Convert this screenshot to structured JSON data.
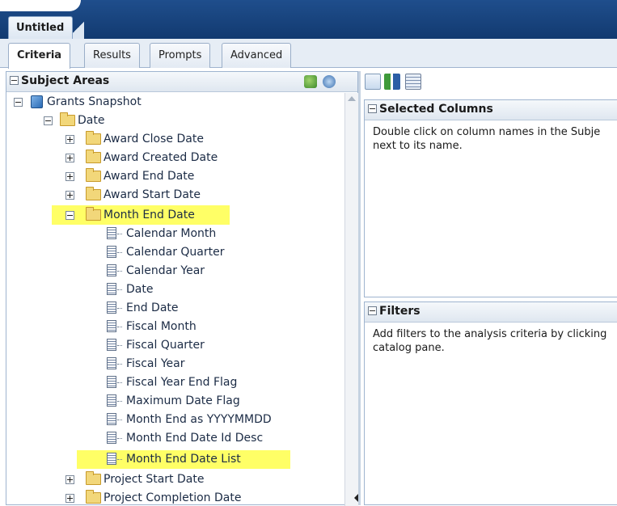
{
  "document_tab": "Untitled",
  "tabs": [
    "Criteria",
    "Results",
    "Prompts",
    "Advanced"
  ],
  "active_tab": "Criteria",
  "subject_areas": {
    "title": "Subject Areas",
    "header_icons": [
      "add-subject-area-icon",
      "refresh-icon"
    ]
  },
  "tree": {
    "root": "Grants Snapshot",
    "date_folder": "Date",
    "folders_before": [
      "Award Close Date",
      "Award Created Date",
      "Award End Date",
      "Award Start Date"
    ],
    "expanded_folder": "Month End Date",
    "columns": [
      "Calendar Month",
      "Calendar Quarter",
      "Calendar Year",
      "Date",
      "End Date",
      "Fiscal Month",
      "Fiscal Quarter",
      "Fiscal Year",
      "Fiscal Year End Flag",
      "Maximum Date Flag",
      "Month End as YYYYMMDD",
      "Month End Date Id Desc",
      "Month End Date List"
    ],
    "folders_after": [
      "Project Start Date",
      "Project Completion Date"
    ]
  },
  "toolbar_icons": [
    "filter-icon",
    "sort-icon",
    "column-properties-icon"
  ],
  "selected_columns": {
    "title": "Selected Columns",
    "text_line1": "Double click on column names in the Subje",
    "text_line2": "next to its name."
  },
  "filters": {
    "title": "Filters",
    "text_line1": "Add filters to the analysis criteria by clicking",
    "text_line2": "catalog pane."
  },
  "colors": {
    "highlight": "#ffff66",
    "brand_blue": "#1f4e8c"
  }
}
